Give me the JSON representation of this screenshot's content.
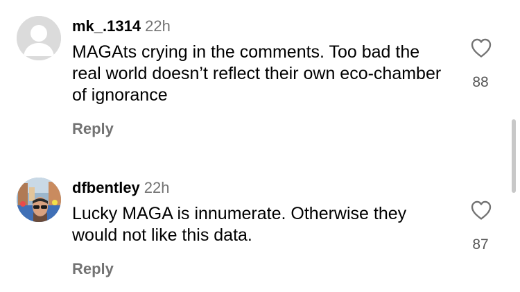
{
  "comments": [
    {
      "username": "mk_.1314",
      "timestamp": "22h",
      "avatar_icon": "default-profile-icon",
      "text": "MAGAts crying in the comments. Too bad the real world doesn’t reflect their own eco-chamber of ignorance",
      "like_count": "88",
      "reply_label": "Reply"
    },
    {
      "username": "dfbentley",
      "timestamp": "22h",
      "avatar_icon": "profile-photo",
      "text": "Lucky MAGA is innumerate.  Otherwise they would not like this data.",
      "like_count": "87",
      "reply_label": "Reply"
    }
  ],
  "icons": {
    "like": "heart-outline-icon"
  },
  "colors": {
    "text": "#000000",
    "secondary": "#737373",
    "like_count": "#555555",
    "avatar_default": "#dbdbdb"
  }
}
